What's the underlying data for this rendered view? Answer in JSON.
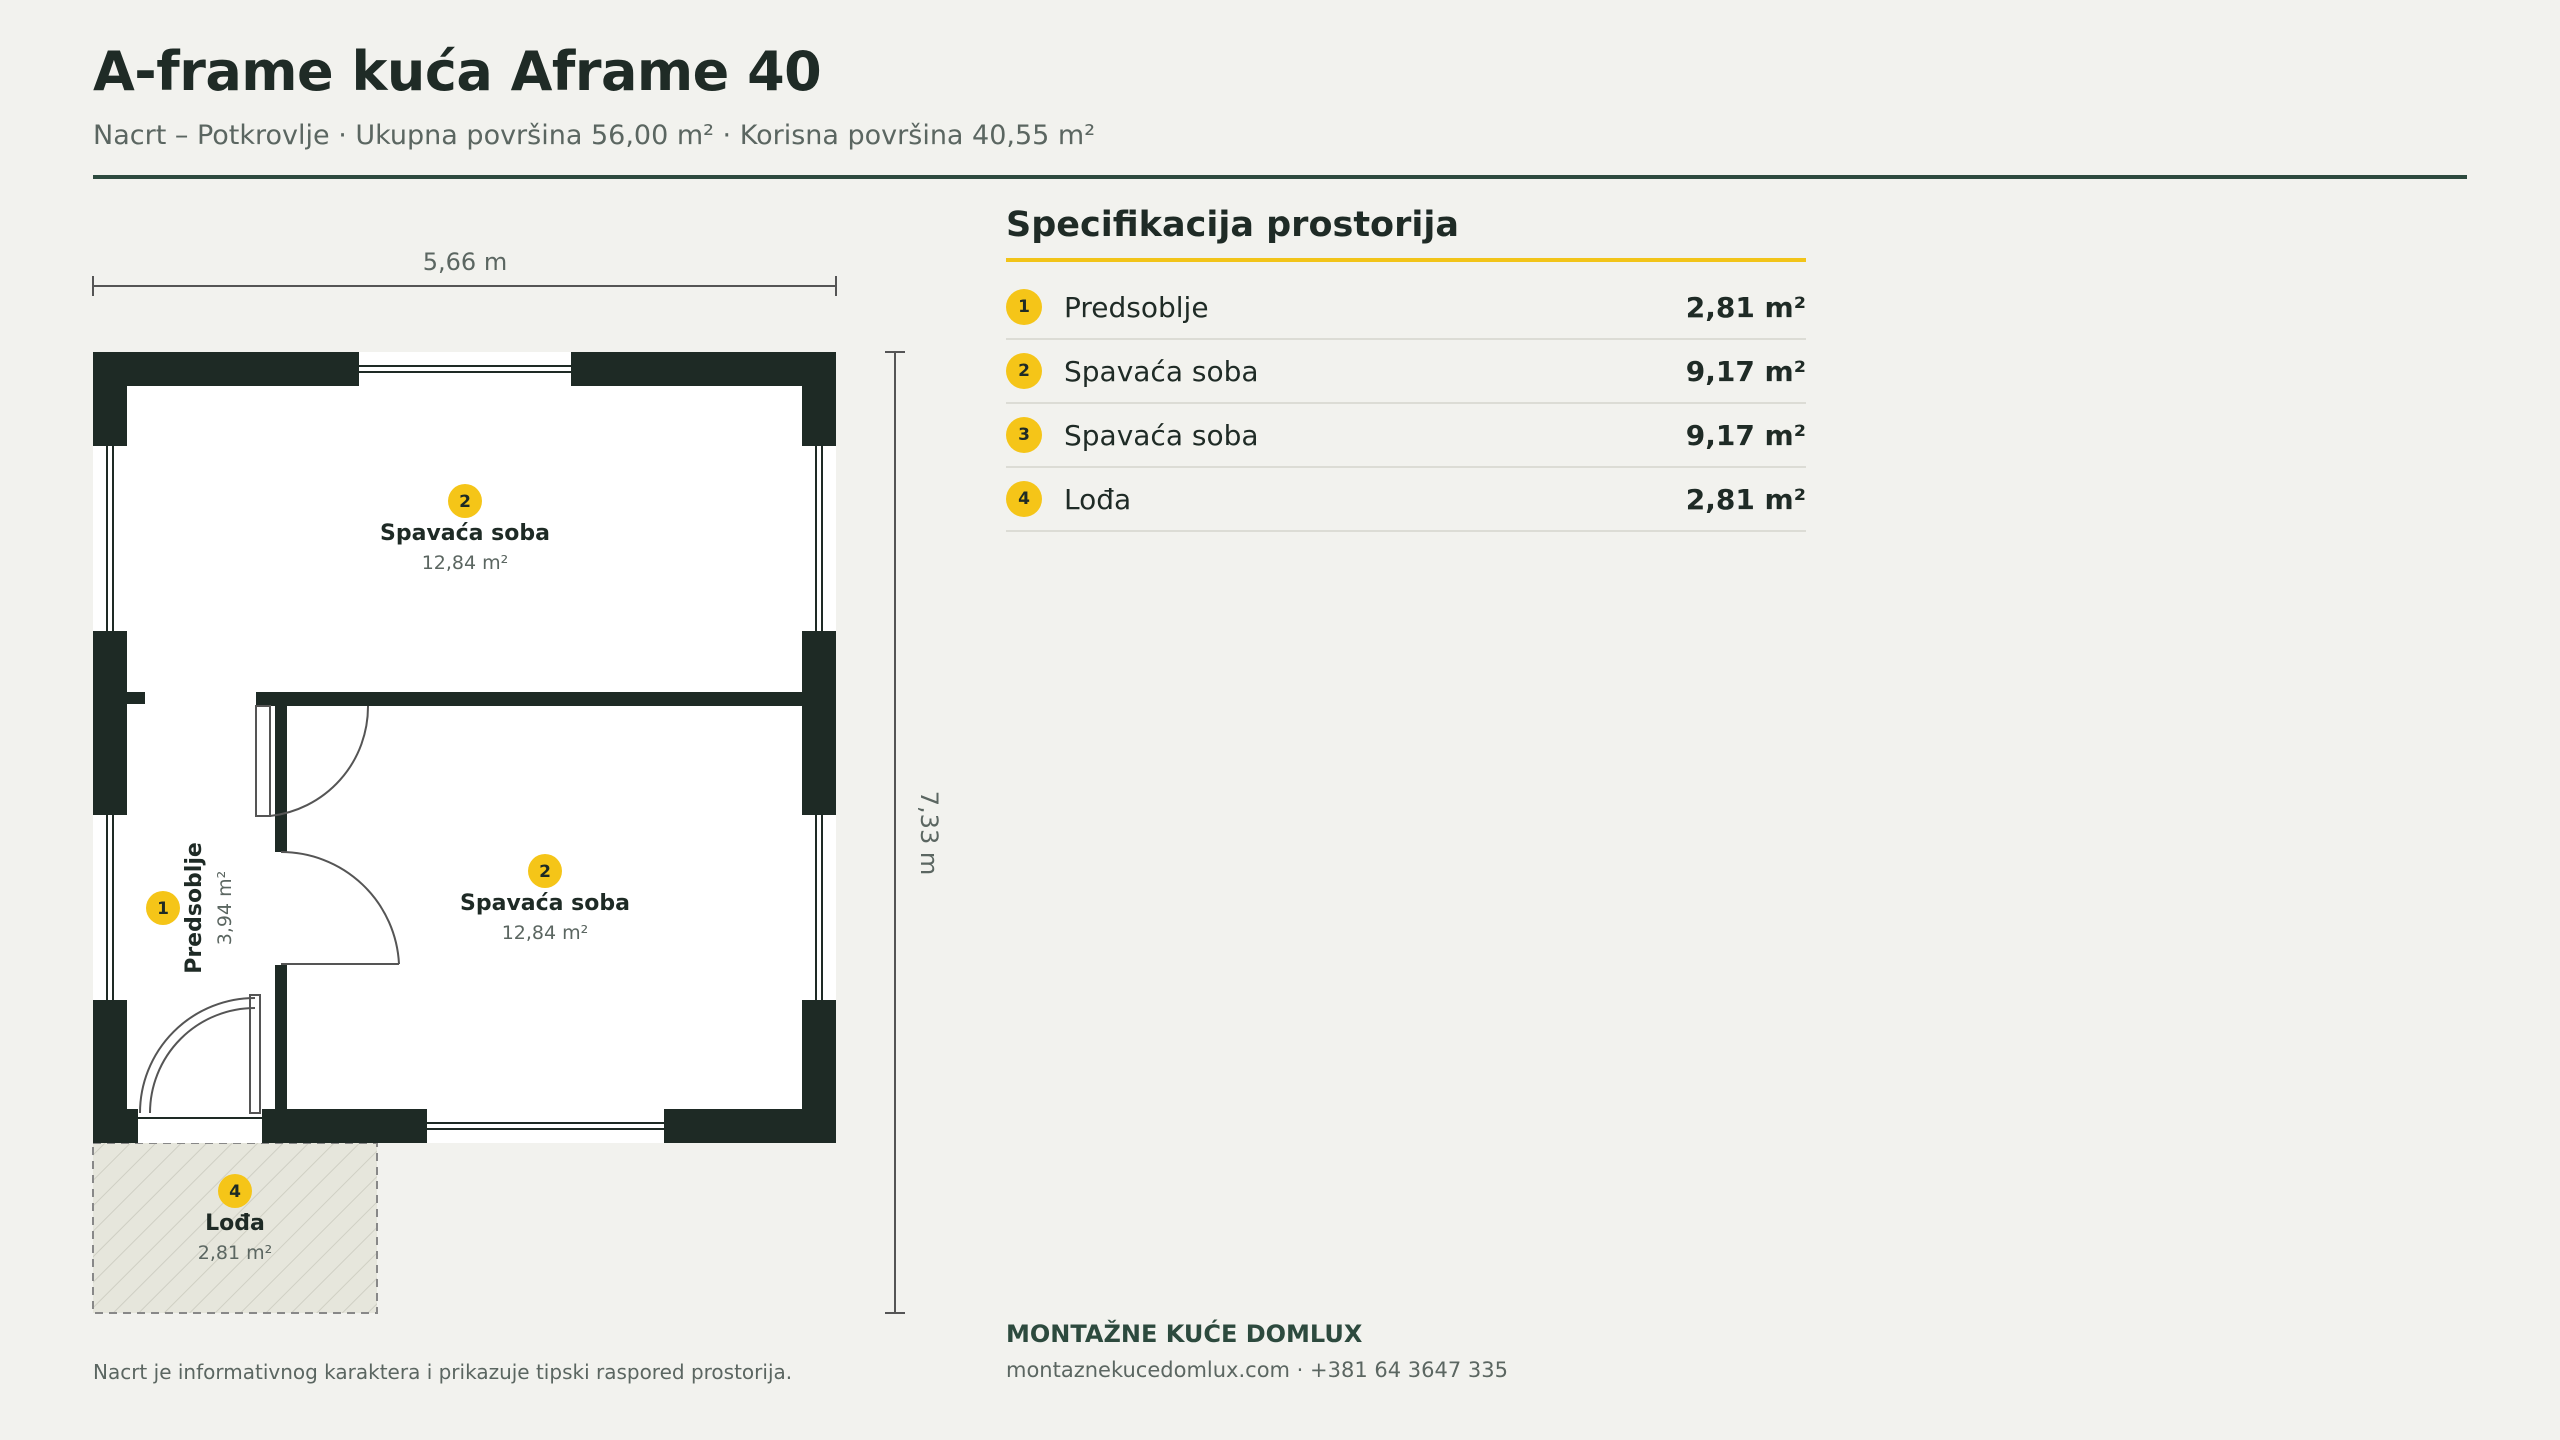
{
  "header": {
    "title": "A-frame kuća Aframe 40",
    "subtitle": "Nacrt – Potkrovlje · Ukupna površina 56,00 m² · Korisna površina 40,55 m²"
  },
  "plan": {
    "width_label": "5,66 m",
    "height_label": "7,33 m",
    "rooms": [
      {
        "num": "2",
        "name": "Spavaća soba",
        "area": "12,84 m²"
      },
      {
        "num": "2",
        "name": "Spavaća soba",
        "area": "12,84 m²"
      },
      {
        "num": "1",
        "name": "Predsoblje",
        "area": "3,94 m²"
      },
      {
        "num": "4",
        "name": "Lođa",
        "area": "2,81 m²"
      }
    ]
  },
  "spec": {
    "title": "Specifikacija prostorija",
    "rows": [
      {
        "num": "1",
        "name": "Predsoblje",
        "area": "2,81 m²"
      },
      {
        "num": "2",
        "name": "Spavaća soba",
        "area": "9,17 m²"
      },
      {
        "num": "3",
        "name": "Spavaća soba",
        "area": "9,17 m²"
      },
      {
        "num": "4",
        "name": "Lođa",
        "area": "2,81 m²"
      }
    ]
  },
  "footer": {
    "brand": "MONTAŽNE KUĆE DOMLUX",
    "contact": "montaznekucedomlux.com · +381 64 3647 335",
    "note": "Nacrt je informativnog karaktera i prikazuje tipski raspored prostorija."
  },
  "colors": {
    "wall": "#1e2a25",
    "accent": "#f5c518",
    "brand": "#2d4a3e",
    "background": "#f2f2ee"
  }
}
